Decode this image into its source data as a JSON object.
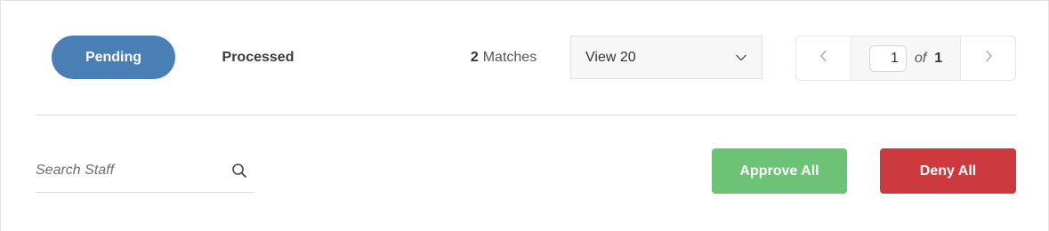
{
  "tabs": {
    "pending_label": "Pending",
    "processed_label": "Processed",
    "active": "Pending"
  },
  "results": {
    "count": "2",
    "label": "Matches"
  },
  "view_select": {
    "selected": "View 20",
    "icon": "chevron-down-icon"
  },
  "pagination": {
    "current_page": "1",
    "of_label": "of",
    "total_pages": "1",
    "prev_icon": "chevron-left-icon",
    "next_icon": "chevron-right-icon"
  },
  "search": {
    "placeholder": "Search Staff",
    "value": "",
    "icon": "search-icon"
  },
  "actions": {
    "approve_label": "Approve All",
    "deny_label": "Deny All"
  },
  "colors": {
    "tab_active": "#4a7fb5",
    "approve": "#6dc375",
    "deny": "#cc3a3d"
  }
}
